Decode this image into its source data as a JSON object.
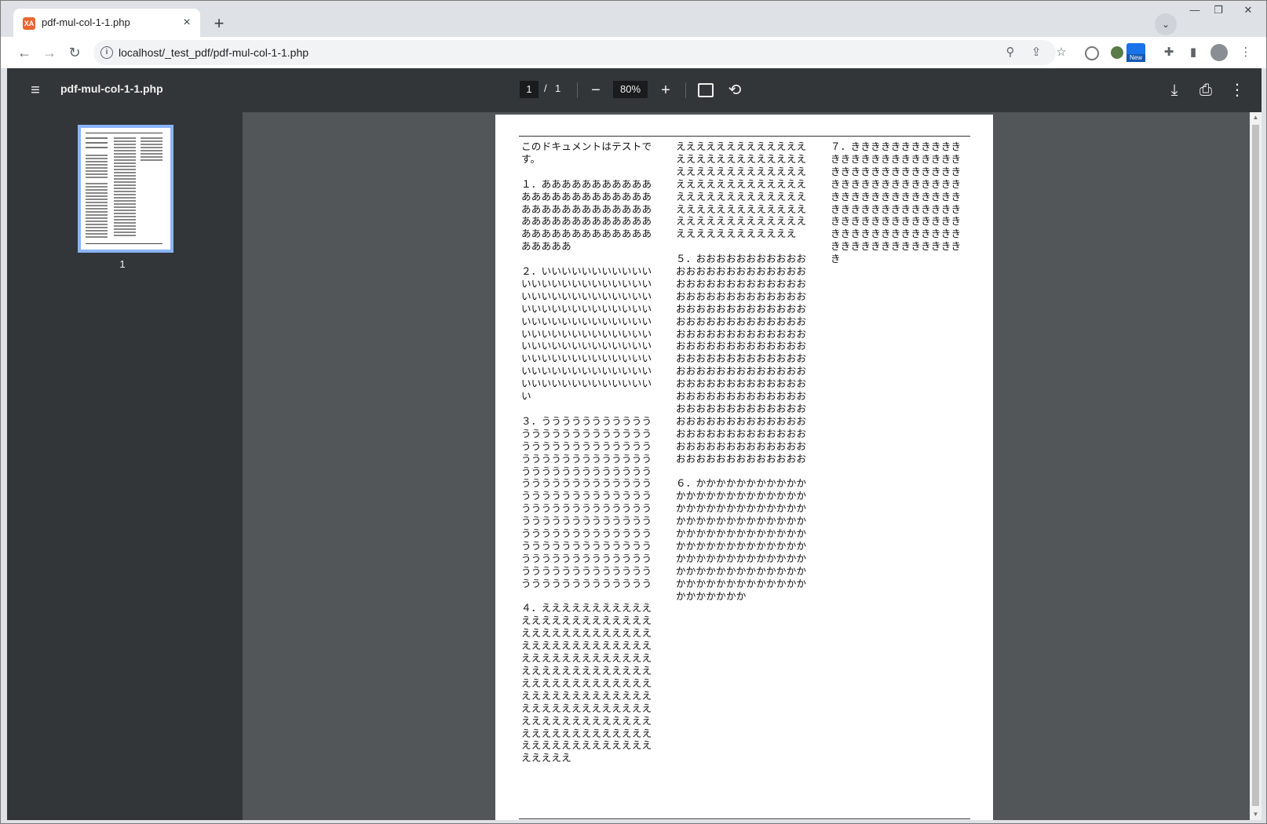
{
  "browser": {
    "tab_title": "pdf-mul-col-1-1.php",
    "favicon_label": "XA",
    "url": "localhost/_test_pdf/pdf-mul-col-1-1.php",
    "new_badge": "New"
  },
  "viewer": {
    "doc_title": "pdf-mul-col-1-1.php",
    "current_page": "1",
    "page_separator": "/",
    "total_pages": "1",
    "zoom": "80%",
    "thumbnail_label": "1"
  },
  "document": {
    "columns": [
      [
        "このドキュメントはテストです。",
        "１．ああああああああああああああああああああああああああああああああああああああああああああああああああああああああああああああああああああ",
        "２．いいいいいいいいいいいいいいいいいいいいいいいいいいいいいいいいいいいいいいいいいいいいいいいいいいいいいいいいいいいいいいいいいいいいいいいいいいいいいいいいいいいいいいいいいいいいいいいいいいいいいいいいいいいいいいいいいいいいいいいいいいいいいいいいい",
        "３．うううううううううううううううううううううううううううううううううううううううううううううううううううううううううううううううううううううううううううううううううううううううううううううううううううううううううううううううううううううううううううううううううううううううううううううううううううううううううううううううううううううううううううううううううううう",
        "４．えええええええええええええええええええええええええええええええええええええええええええええええええええええええええええええええええええええええええええええええええええええええええええええええええええええええええええええええええええええええええええええええええええええええええええええええええええええええええええええええ"
      ],
      [
        "えええええええええええええええええええええええええええええええええええええええええええええええええええええええええええええええええええええええええええええええええええええええええええええええええええええええ",
        "５．おおおおおおおおおおおおおおおおおおおおおおおおおおおおおおおおおおおおおおおおおおおおおおおおおおおおおおおおおおおおおおおおおおおおおおおおおおおおおおおおおおおおおおおおおおおおおおおおおおおおおおおおおおおおおおおおおおおおおおおおおおおおおおおおおおおおおおおおおおおおおおおおおおおおおおおおおおおおおおおおおおおおおおおおおおおおおおおおおおおおおおおおおおおおおおおおおおおおおおおおおおおおおおおおおおおおおおおおおおお",
        "６．かかかかかかかかかかかかかかかかかかかかかかかかかかかかかかかかかかかかかかかかかかかかかかかかかかかかかかかかかかかかかかかかかかかかかかかかかかかかかかかかかかかかかかかかかかかかかかかかかかかかかかかかかかかかかかかかかかかかかかかかかか"
      ],
      [
        "７．きききききききききききききききききききききききききききききききききききききききききききききききききききききききききききききききききききききききききききききききききききききききききききききききききききききききききききききききききききき"
      ]
    ]
  },
  "colors": {
    "viewer_bg": "#525659",
    "toolbar_bg": "#323639",
    "accent": "#8ab4f8"
  }
}
